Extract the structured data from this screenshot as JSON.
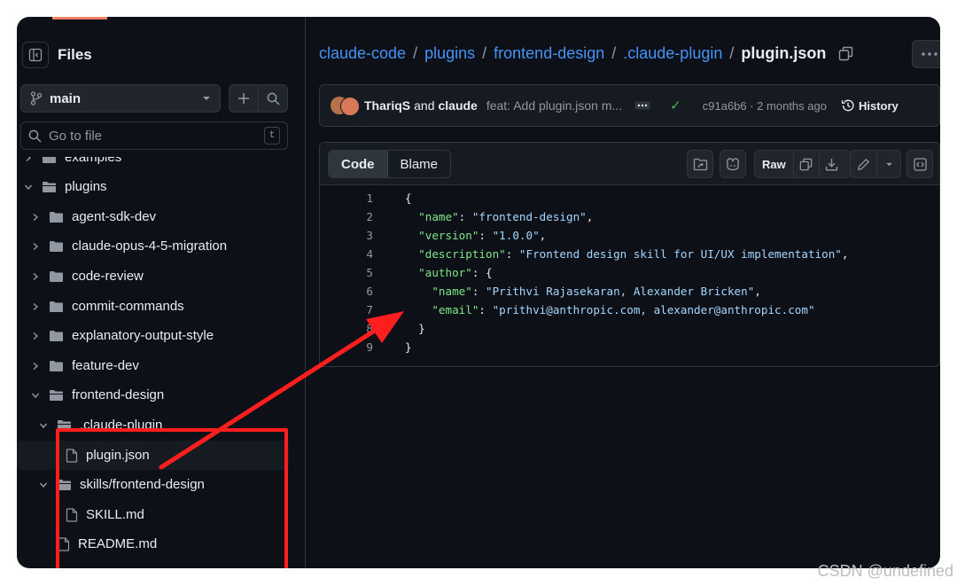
{
  "sidebar": {
    "title": "Files",
    "branch": "main",
    "search_placeholder": "Go to file",
    "search_shortcut": "t",
    "tree": [
      {
        "label": "examples",
        "type": "folder",
        "expanded": false,
        "depth": 0
      },
      {
        "label": "plugins",
        "type": "folder",
        "expanded": true,
        "depth": 0
      },
      {
        "label": "agent-sdk-dev",
        "type": "folder",
        "expanded": false,
        "depth": 1
      },
      {
        "label": "claude-opus-4-5-migration",
        "type": "folder",
        "expanded": false,
        "depth": 1
      },
      {
        "label": "code-review",
        "type": "folder",
        "expanded": false,
        "depth": 1
      },
      {
        "label": "commit-commands",
        "type": "folder",
        "expanded": false,
        "depth": 1
      },
      {
        "label": "explanatory-output-style",
        "type": "folder",
        "expanded": false,
        "depth": 1
      },
      {
        "label": "feature-dev",
        "type": "folder",
        "expanded": false,
        "depth": 1
      },
      {
        "label": "frontend-design",
        "type": "folder",
        "expanded": true,
        "depth": 1
      },
      {
        "label": ".claude-plugin",
        "type": "folder",
        "expanded": true,
        "depth": 2
      },
      {
        "label": "plugin.json",
        "type": "file",
        "selected": true,
        "depth": 3
      },
      {
        "label": "skills/frontend-design",
        "type": "folder",
        "expanded": true,
        "depth": 2
      },
      {
        "label": "SKILL.md",
        "type": "file",
        "depth": 3
      },
      {
        "label": "README.md",
        "type": "file",
        "depth": 2
      }
    ]
  },
  "breadcrumb": {
    "parts": [
      "claude-code",
      "plugins",
      "frontend-design",
      ".claude-plugin"
    ],
    "current": "plugin.json"
  },
  "commit": {
    "author1": "ThariqS",
    "and_text": "and",
    "author2": "claude",
    "message": "feat: Add plugin.json m...",
    "sha_time": "c91a6b6 · 2 months ago",
    "history_label": "History"
  },
  "file": {
    "tab_code": "Code",
    "tab_blame": "Blame",
    "raw_label": "Raw",
    "lines": [
      {
        "n": "1",
        "html": "{"
      },
      {
        "n": "2",
        "html": "  <span class=\"k\">\"name\"</span>: <span class=\"s\">\"frontend-design\"</span>,"
      },
      {
        "n": "3",
        "html": "  <span class=\"k\">\"version\"</span>: <span class=\"s\">\"1.0.0\"</span>,"
      },
      {
        "n": "4",
        "html": "  <span class=\"k\">\"description\"</span>: <span class=\"s\">\"Frontend design skill for UI/UX implementation\"</span>,"
      },
      {
        "n": "5",
        "html": "  <span class=\"k\">\"author\"</span>: {"
      },
      {
        "n": "6",
        "html": "    <span class=\"k\">\"name\"</span>: <span class=\"s\">\"Prithvi Rajasekaran, Alexander Bricken\"</span>,"
      },
      {
        "n": "7",
        "html": "    <span class=\"k\">\"email\"</span>: <span class=\"s\">\"prithvi@anthropic.com, alexander@anthropic.com\"</span>"
      },
      {
        "n": "8",
        "html": "  }"
      },
      {
        "n": "9",
        "html": "}"
      }
    ]
  },
  "colors": {
    "background": "#0d1117",
    "link": "#4493f8",
    "json_key": "#7ee787",
    "json_string": "#a5d6ff",
    "annotation": "#ff1e1e"
  },
  "watermark": "CSDN @undefined"
}
